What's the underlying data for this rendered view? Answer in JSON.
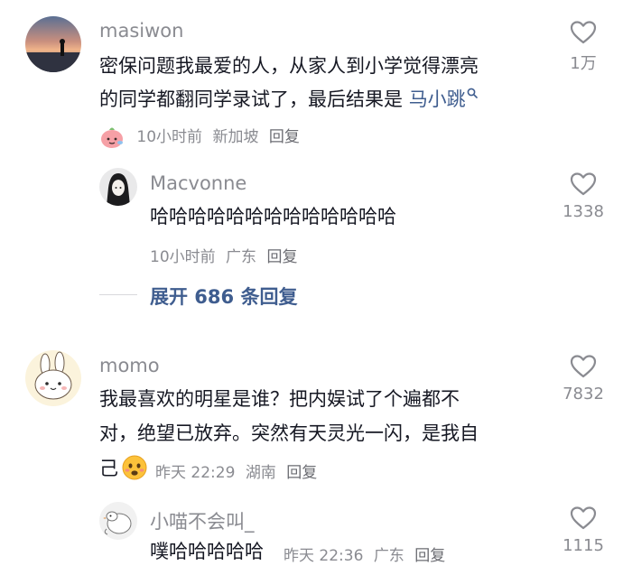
{
  "comments": [
    {
      "username": "masiwon",
      "text_line1": "密保问题我最爱的人，从家人到小学觉得漂亮",
      "text_line2_prefix": "的同学都翻同学录试了，最后结果是 ",
      "link_text": "马小跳",
      "time": "10小时前",
      "location": "新加坡",
      "reply_label": "回复",
      "likes": "1万",
      "replies": [
        {
          "username": "Macvonne",
          "text": "哈哈哈哈哈哈哈哈哈哈哈哈哈",
          "time": "10小时前",
          "location": "广东",
          "reply_label": "回复",
          "likes": "1338"
        }
      ],
      "expand_label": "展开 686 条回复"
    },
    {
      "username": "momo",
      "text_line1": "我最喜欢的明星是谁？把内娱试了个遍都不",
      "text_line2": "对，绝望已放弃。突然有天灵光一闪，是我自",
      "text_line3": "己",
      "time": "昨天 22:29",
      "location": "湖南",
      "reply_label": "回复",
      "likes": "7832",
      "replies": [
        {
          "username": "小喵不会叫_",
          "text": "噗哈哈哈哈哈",
          "time": "昨天 22:36",
          "location": "广东",
          "reply_label": "回复",
          "likes": "1115"
        }
      ]
    }
  ],
  "colors": {
    "text": "#161823",
    "muted": "#8a8b91",
    "link": "#3f5d8f"
  },
  "icons": [
    "heart-outline-icon",
    "search-icon",
    "peach-face-emoji",
    "worried-face-emoji"
  ]
}
